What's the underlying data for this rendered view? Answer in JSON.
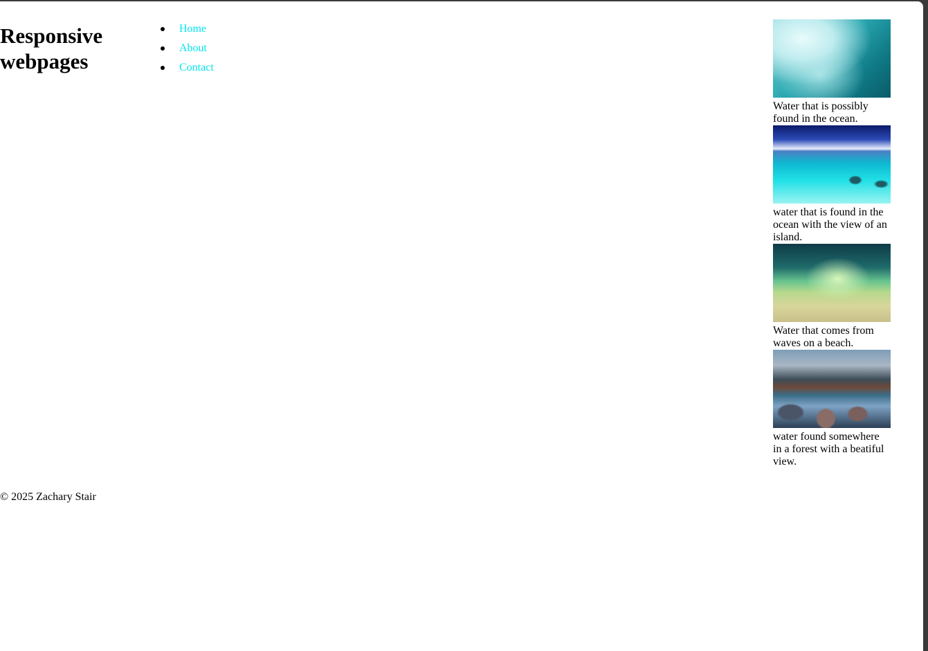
{
  "header": {
    "title": "Responsive webpages"
  },
  "nav": {
    "items": [
      {
        "label": "Home"
      },
      {
        "label": "About"
      },
      {
        "label": "Contact"
      }
    ]
  },
  "gallery": {
    "items": [
      {
        "caption": "Water that is possibly found in the ocean."
      },
      {
        "caption": "water that is found in the ocean with the view of an island."
      },
      {
        "caption": "Water that comes from waves on a beach."
      },
      {
        "caption": "water found somewhere in a forest with a beatiful view."
      }
    ]
  },
  "footer": {
    "text": "© 2025 Zachary Stair"
  },
  "colors": {
    "link": "#00e5ee",
    "background": "#ffffff"
  }
}
